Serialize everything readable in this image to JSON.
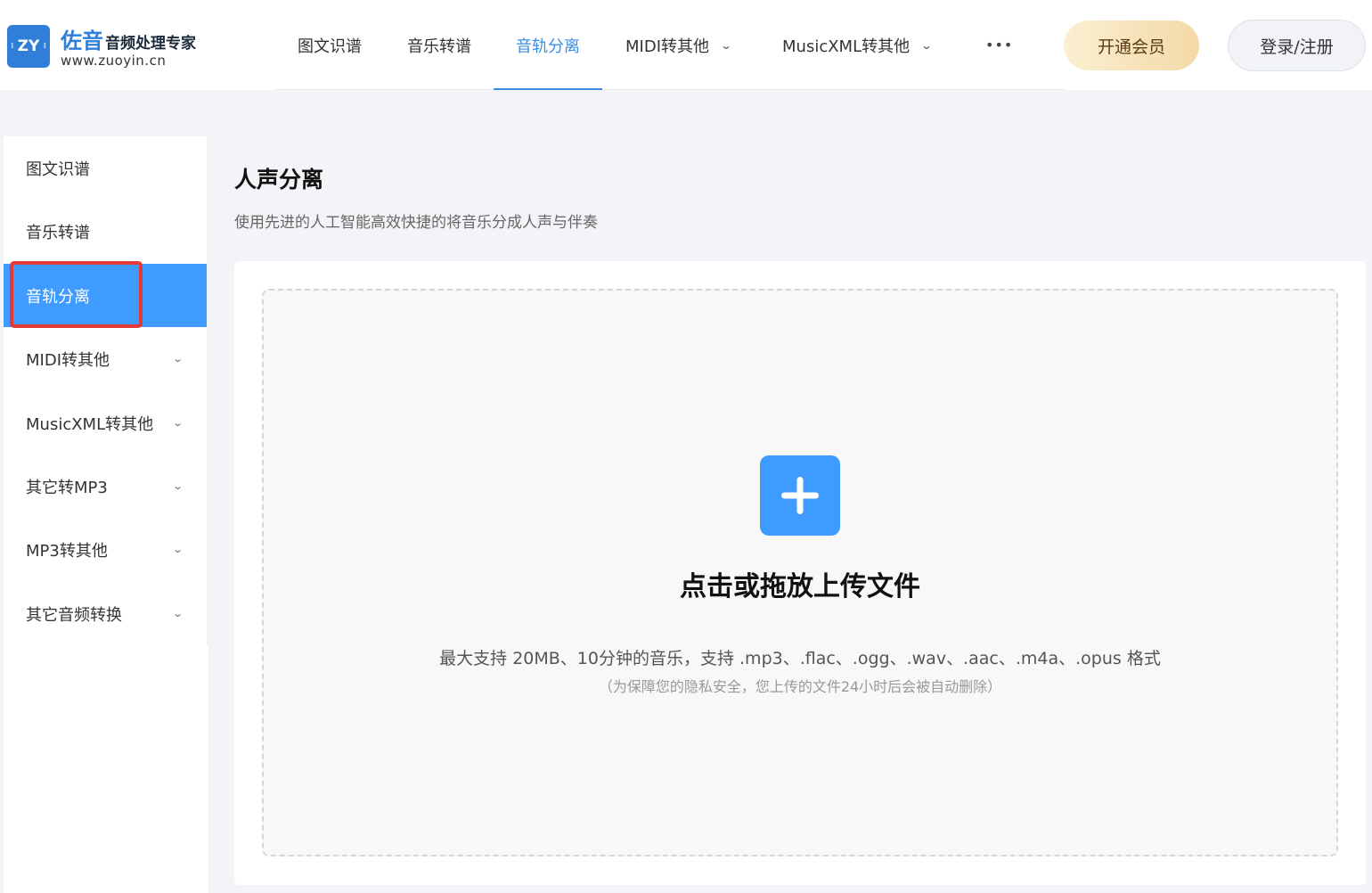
{
  "header": {
    "logo_badge": "ZY",
    "logo_brand": "佐音",
    "logo_tagline": "音频处理专家",
    "logo_url": "www.zuoyin.cn",
    "nav": [
      {
        "label": "图文识谱"
      },
      {
        "label": "音乐转谱"
      },
      {
        "label": "音轨分离",
        "active": true
      },
      {
        "label": "MIDI转其他",
        "has_dropdown": true
      },
      {
        "label": "MusicXML转其他",
        "has_dropdown": true
      },
      {
        "label": "•••"
      }
    ],
    "vip_label": "开通会员",
    "login_label": "登录/注册"
  },
  "sidebar": {
    "items": [
      {
        "label": "图文识谱"
      },
      {
        "label": "音乐转谱"
      },
      {
        "label": "音轨分离",
        "active": true
      },
      {
        "label": "MIDI转其他",
        "has_dropdown": true
      },
      {
        "label": "MusicXML转其他",
        "has_dropdown": true
      },
      {
        "label": "其它转MP3",
        "has_dropdown": true
      },
      {
        "label": "MP3转其他",
        "has_dropdown": true
      },
      {
        "label": "其它音频转换",
        "has_dropdown": true
      }
    ]
  },
  "main": {
    "title": "人声分离",
    "subtitle": "使用先进的人工智能高效快捷的将音乐分成人声与伴奏",
    "upload": {
      "icon": "plus-icon",
      "title": "点击或拖放上传文件",
      "hint": "最大支持 20MB、10分钟的音乐，支持 .mp3、.flac、.ogg、.wav、.aac、.m4a、.opus 格式",
      "note": "（为保障您的隐私安全，您上传的文件24小时后会被自动删除）"
    }
  },
  "colors": {
    "accent": "#3f9bff",
    "nav_active": "#3a8ee6",
    "highlight": "#e53935"
  }
}
